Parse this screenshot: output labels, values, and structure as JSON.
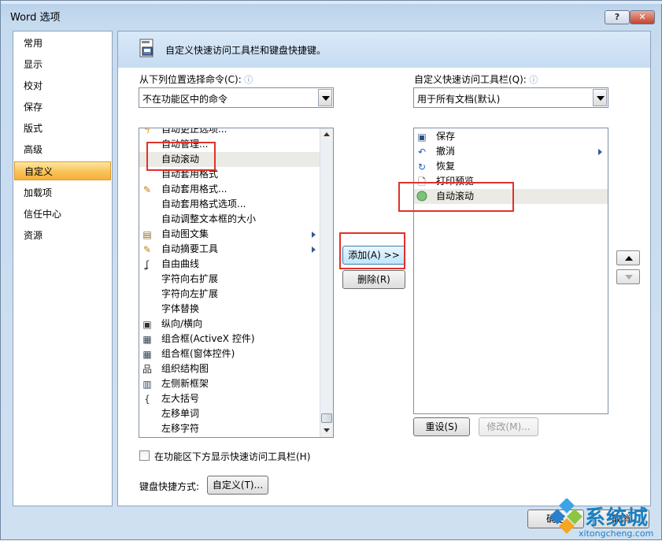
{
  "window": {
    "title": "Word 选项",
    "help": "?",
    "close": "✕"
  },
  "nav": {
    "items": [
      "常用",
      "显示",
      "校对",
      "保存",
      "版式",
      "高级",
      "自定义",
      "加载项",
      "信任中心",
      "资源"
    ],
    "selected": "自定义"
  },
  "banner": {
    "text": "自定义快速访问工具栏和键盘快捷键。"
  },
  "left": {
    "label": "从下列位置选择命令(C):",
    "combo_value": "不在功能区中的命令",
    "commands": [
      {
        "label": "自动更正选项...",
        "icon": "lightning-icon"
      },
      {
        "label": "自动管理...",
        "icon": ""
      },
      {
        "label": "自动滚动",
        "icon": "",
        "highlighted": true
      },
      {
        "label": "自动套用格式",
        "icon": ""
      },
      {
        "label": "自动套用格式...",
        "icon": "autoformat-icon"
      },
      {
        "label": "自动套用格式选项...",
        "icon": ""
      },
      {
        "label": "自动调整文本框的大小",
        "icon": ""
      },
      {
        "label": "自动图文集",
        "icon": "autotext-icon",
        "submenu": true
      },
      {
        "label": "自动摘要工具",
        "icon": "summary-icon",
        "submenu": true
      },
      {
        "label": "自由曲线",
        "icon": "freeform-icon"
      },
      {
        "label": "字符向右扩展",
        "icon": ""
      },
      {
        "label": "字符向左扩展",
        "icon": ""
      },
      {
        "label": "字体替换",
        "icon": ""
      },
      {
        "label": "纵向/横向",
        "icon": "orientation-icon"
      },
      {
        "label": "组合框(ActiveX 控件)",
        "icon": "combobox-icon"
      },
      {
        "label": "组合框(窗体控件)",
        "icon": "combobox-icon"
      },
      {
        "label": "组织结构图",
        "icon": "orgchart-icon"
      },
      {
        "label": "左侧新框架",
        "icon": "frame-icon"
      },
      {
        "label": "左大括号",
        "icon": "brace-icon"
      },
      {
        "label": "左移单词",
        "icon": ""
      },
      {
        "label": "左移字符",
        "icon": ""
      }
    ]
  },
  "middle": {
    "add": "添加(A) >>",
    "remove": "删除(R)"
  },
  "right": {
    "label": "自定义快速访问工具栏(Q):",
    "combo_value": "用于所有文档(默认)",
    "items": [
      {
        "label": "保存",
        "icon": "save-icon"
      },
      {
        "label": "撤消",
        "icon": "undo-icon",
        "submenu": true
      },
      {
        "label": "恢复",
        "icon": "redo-icon"
      },
      {
        "label": "打印预览",
        "icon": "print-preview-icon"
      },
      {
        "label": "自动滚动",
        "icon": "autoscroll-icon",
        "highlighted": true
      }
    ],
    "reset": "重设(S)",
    "modify": "修改(M)..."
  },
  "options": {
    "show_below_label": "在功能区下方显示快速访问工具栏(H)",
    "keyboard_label": "键盘快捷方式:",
    "keyboard_button": "自定义(T)..."
  },
  "footer": {
    "ok": "确定",
    "cancel": "取消"
  },
  "watermark": {
    "name": "系统城",
    "url": "xitongcheng.com"
  },
  "colors": {
    "selection": "#f8c257",
    "highlight_box": "#e0322c",
    "accent": "#1a7fc2"
  }
}
